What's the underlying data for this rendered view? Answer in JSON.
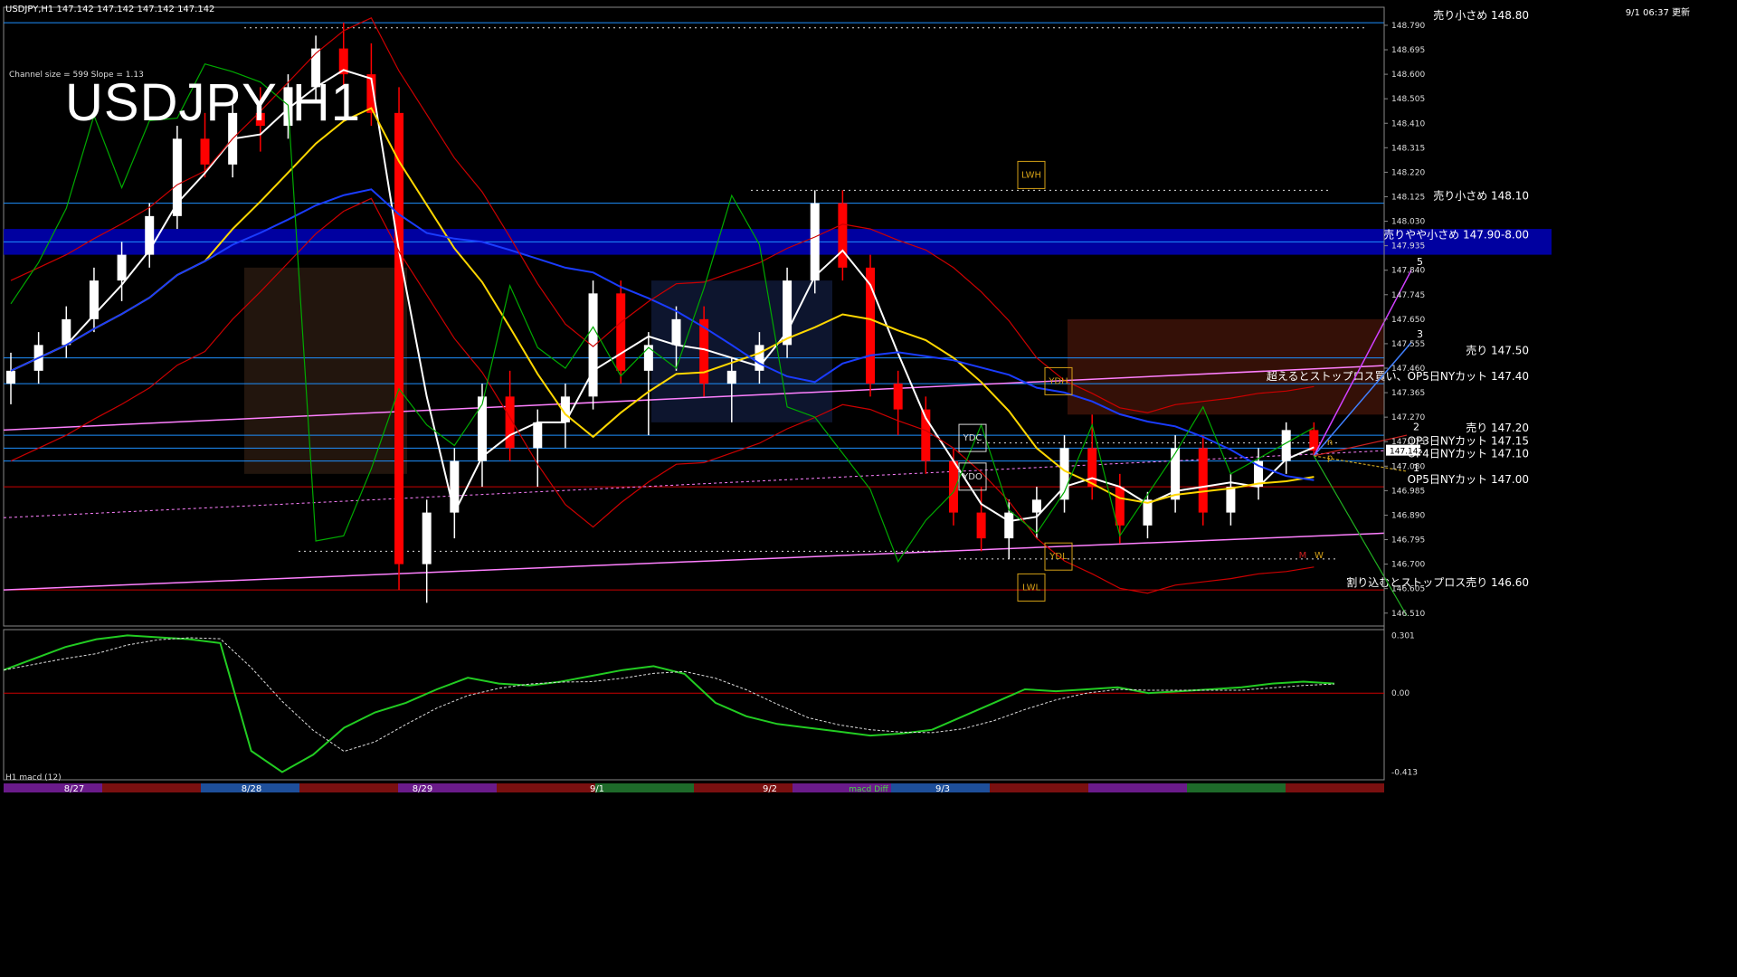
{
  "header": {
    "symbol_info": "USDJPY,H1  147.142 147.142 147.142 147.142",
    "updated": "9/1 06:37 更新"
  },
  "chart_title": "USDJPY H1",
  "channel_info": "Channel size = 599 Slope = 1.13",
  "macd_label": "H1  macd (12)",
  "macd_scale_labels": [
    "0.301",
    "0.00",
    "-0.413"
  ],
  "price_axis_labels": [
    "148.790",
    "148.695",
    "148.600",
    "148.505",
    "148.410",
    "148.315",
    "148.220",
    "148.125",
    "148.030",
    "147.935",
    "147.840",
    "147.745",
    "147.650",
    "147.555",
    "147.460",
    "147.365",
    "147.270",
    "147.175",
    "147.080",
    "146.985",
    "146.890",
    "146.795",
    "146.700",
    "146.605",
    "146.510"
  ],
  "current_price": "147.142",
  "date_labels": [
    "8/27",
    "8/28",
    "8/29",
    "9/1",
    "9/2",
    "9/3"
  ],
  "bottom_strip_text": "macd Diff",
  "level_labels": [
    {
      "text": "売り小さめ 148.80",
      "price": 148.8,
      "color": "#1e90ff"
    },
    {
      "text": "売り小さめ 148.10",
      "price": 148.1,
      "color": "#1e90ff"
    },
    {
      "text": "売りやや小さめ 147.90-8.00",
      "price": 147.95,
      "color": "#1e90ff"
    },
    {
      "text": "売り 147.50",
      "price": 147.5,
      "color": "#1e90ff"
    },
    {
      "text": "超えるとストップロス買い、OP5日NYカット 147.40",
      "price": 147.4,
      "color": "#1e90ff"
    },
    {
      "text": "売り 147.20",
      "price": 147.2,
      "color": "#1e90ff"
    },
    {
      "text": "OP3日NYカット 147.15",
      "price": 147.15,
      "color": "#1e90ff"
    },
    {
      "text": "OP4日NYカット 147.10",
      "price": 147.1,
      "color": "#1e90ff"
    },
    {
      "text": "OP5日NYカット 147.00",
      "price": 147.0,
      "color": "#cc0000"
    },
    {
      "text": "割り込むとストップロス売り 146.60",
      "price": 146.6,
      "color": "#cc0000"
    }
  ],
  "box_labels": [
    "LWH",
    "YDH",
    "YDC",
    "YDO",
    "YDL",
    "LWL",
    "M",
    "W",
    "n",
    "p"
  ],
  "wave_labels": [
    "5",
    "3",
    "2",
    "1"
  ],
  "colors": {
    "bull": "#ffffff",
    "bear": "#ff0000",
    "blue_band": "#0000a0",
    "ma_white": "#ffffff",
    "ma_yellow": "#ffd700",
    "ma_blue": "#1a3cff",
    "bollinger": "#cc0000",
    "chikou": "#00aa00",
    "channel": "#ff80ff",
    "macd_main": "#22cc22",
    "macd_signal": "#dddddd"
  },
  "chart_data": {
    "type": "candlestick",
    "title": "USDJPY H1",
    "ylim": [
      146.46,
      148.86
    ],
    "candles": [
      [
        147.4,
        147.52,
        147.32,
        147.45
      ],
      [
        147.45,
        147.6,
        147.4,
        147.55
      ],
      [
        147.55,
        147.7,
        147.5,
        147.65
      ],
      [
        147.65,
        147.85,
        147.6,
        147.8
      ],
      [
        147.8,
        147.95,
        147.72,
        147.9
      ],
      [
        147.9,
        148.1,
        147.85,
        148.05
      ],
      [
        148.05,
        148.4,
        148.0,
        148.35
      ],
      [
        148.35,
        148.45,
        148.2,
        148.25
      ],
      [
        148.25,
        148.5,
        148.2,
        148.45
      ],
      [
        148.45,
        148.55,
        148.3,
        148.4
      ],
      [
        148.4,
        148.6,
        148.35,
        148.55
      ],
      [
        148.55,
        148.75,
        148.5,
        148.7
      ],
      [
        148.7,
        148.8,
        148.55,
        148.6
      ],
      [
        148.6,
        148.72,
        148.4,
        148.45
      ],
      [
        148.45,
        148.55,
        146.6,
        146.7
      ],
      [
        146.7,
        146.95,
        146.55,
        146.9
      ],
      [
        146.9,
        147.15,
        146.8,
        147.1
      ],
      [
        147.1,
        147.4,
        147.0,
        147.35
      ],
      [
        147.35,
        147.45,
        147.1,
        147.15
      ],
      [
        147.15,
        147.3,
        147.0,
        147.25
      ],
      [
        147.25,
        147.4,
        147.15,
        147.35
      ],
      [
        147.35,
        147.8,
        147.3,
        147.75
      ],
      [
        147.75,
        147.8,
        147.4,
        147.45
      ],
      [
        147.45,
        147.6,
        147.2,
        147.55
      ],
      [
        147.55,
        147.7,
        147.45,
        147.65
      ],
      [
        147.65,
        147.7,
        147.35,
        147.4
      ],
      [
        147.4,
        147.5,
        147.25,
        147.45
      ],
      [
        147.45,
        147.6,
        147.4,
        147.55
      ],
      [
        147.55,
        147.85,
        147.5,
        147.8
      ],
      [
        147.8,
        148.15,
        147.75,
        148.1
      ],
      [
        148.1,
        148.15,
        147.8,
        147.85
      ],
      [
        147.85,
        147.9,
        147.35,
        147.4
      ],
      [
        147.4,
        147.45,
        147.2,
        147.3
      ],
      [
        147.3,
        147.35,
        147.05,
        147.1
      ],
      [
        147.1,
        147.15,
        146.85,
        146.9
      ],
      [
        146.9,
        147.0,
        146.75,
        146.8
      ],
      [
        146.8,
        146.95,
        146.72,
        146.9
      ],
      [
        146.9,
        147.0,
        146.8,
        146.95
      ],
      [
        146.95,
        147.2,
        146.9,
        147.15
      ],
      [
        147.15,
        147.28,
        146.95,
        147.0
      ],
      [
        147.0,
        147.05,
        146.78,
        146.85
      ],
      [
        146.85,
        146.98,
        146.8,
        146.95
      ],
      [
        146.95,
        147.2,
        146.9,
        147.15
      ],
      [
        147.15,
        147.2,
        146.85,
        146.9
      ],
      [
        146.9,
        147.05,
        146.85,
        147.0
      ],
      [
        147.0,
        147.15,
        146.95,
        147.1
      ],
      [
        147.1,
        147.25,
        147.05,
        147.22
      ],
      [
        147.22,
        147.25,
        147.12,
        147.14
      ]
    ],
    "macd": [
      0.12,
      0.18,
      0.24,
      0.28,
      0.3,
      0.29,
      0.28,
      0.26,
      -0.3,
      -0.41,
      -0.32,
      -0.18,
      -0.1,
      -0.05,
      0.02,
      0.08,
      0.05,
      0.04,
      0.06,
      0.09,
      0.12,
      0.14,
      0.1,
      -0.05,
      -0.12,
      -0.16,
      -0.18,
      -0.2,
      -0.22,
      -0.21,
      -0.19,
      -0.12,
      -0.05,
      0.02,
      0.01,
      0.02,
      0.03,
      0.0,
      0.01,
      0.02,
      0.03,
      0.05,
      0.06,
      0.05
    ],
    "macd_ylim": [
      -0.45,
      0.33
    ]
  }
}
